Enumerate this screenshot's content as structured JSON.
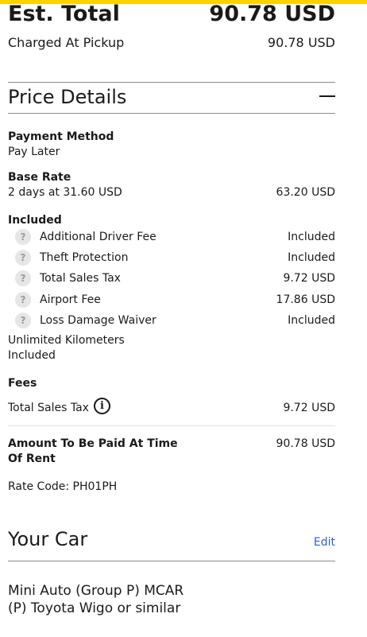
{
  "summary": {
    "est_total_label": "Est. Total",
    "est_total_value": "90.78 USD",
    "charged_label": "Charged At Pickup",
    "charged_value": "90.78 USD"
  },
  "price_details": {
    "title": "Price Details",
    "payment_method_label": "Payment Method",
    "payment_method_value": "Pay Later",
    "base_rate_label": "Base Rate",
    "base_rate_desc": "2 days at 31.60 USD",
    "base_rate_value": "63.20 USD",
    "included_label": "Included",
    "included_items": [
      {
        "name": "Additional Driver Fee",
        "value": "Included"
      },
      {
        "name": "Theft Protection",
        "value": "Included"
      },
      {
        "name": "Total Sales Tax",
        "value": "9.72 USD"
      },
      {
        "name": "Airport Fee",
        "value": "17.86 USD"
      },
      {
        "name": "Loss Damage Waiver",
        "value": "Included"
      }
    ],
    "help_icon_glyph": "?",
    "unlimited_km": "Unlimited Kilometers",
    "unlimited_km_value": "Included",
    "fees_label": "Fees",
    "fees_items": [
      {
        "name": "Total Sales Tax",
        "value": "9.72 USD"
      }
    ],
    "info_icon_glyph": "i",
    "amount_label": "Amount To Be Paid At Time Of Rent",
    "amount_value": "90.78 USD",
    "rate_code": "Rate Code: PH01PH"
  },
  "your_car": {
    "title": "Your Car",
    "edit_label": "Edit",
    "line1": "Mini Auto (Group P) MCAR",
    "line2": "(P) Toyota Wigo or similar"
  },
  "colors": {
    "accent_bar": "#ffd100",
    "link": "#2f5fd0"
  }
}
